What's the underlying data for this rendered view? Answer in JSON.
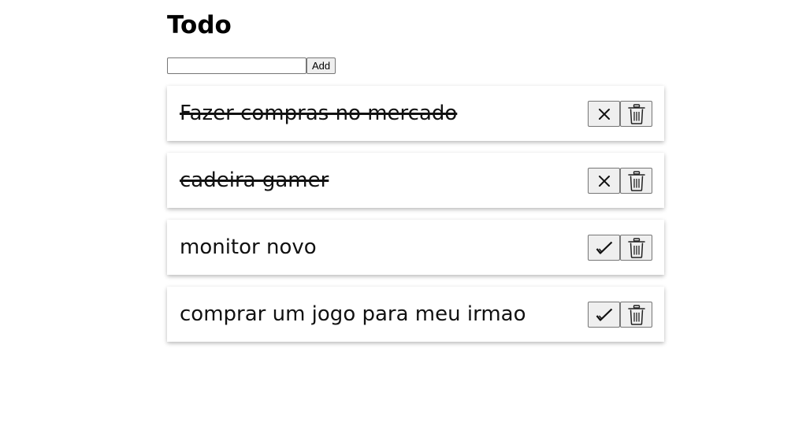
{
  "page": {
    "title": "Todo"
  },
  "add_form": {
    "input_value": "",
    "button_label": "Add"
  },
  "todos": [
    {
      "text": "Fazer compras no mercado",
      "done": true,
      "toggle_icon": "x-icon",
      "delete_icon": "trash-icon"
    },
    {
      "text": "cadeira gamer",
      "done": true,
      "toggle_icon": "x-icon",
      "delete_icon": "trash-icon"
    },
    {
      "text": "monitor novo",
      "done": false,
      "toggle_icon": "check-icon",
      "delete_icon": "trash-icon"
    },
    {
      "text": "comprar um jogo para meu irmao",
      "done": false,
      "toggle_icon": "check-icon",
      "delete_icon": "trash-icon"
    }
  ]
}
